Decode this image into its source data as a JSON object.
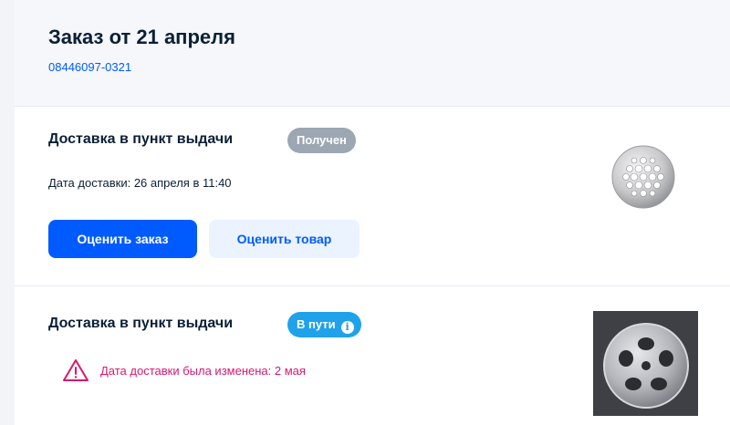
{
  "order": {
    "title": "Заказ от 21 апреля",
    "number": "08446097-0321"
  },
  "shipments": [
    {
      "delivery_type": "Доставка в пункт выдачи",
      "status": "Получен",
      "delivery_date": "Дата доставки: 26 апреля в 11:40",
      "rate_order_label": "Оценить заказ",
      "rate_product_label": "Оценить товар"
    },
    {
      "delivery_type": "Доставка в пункт выдачи",
      "status": "В пути",
      "status_info_icon": "info-icon",
      "warning_icon": "warning-triangle-icon",
      "warning_text": "Дата доставки была изменена: 2 мая"
    }
  ],
  "colors": {
    "accent": "#005bff",
    "received_badge": "#9da7b3",
    "transit_badge": "#1fa2ea",
    "warning": "#d6186f"
  }
}
